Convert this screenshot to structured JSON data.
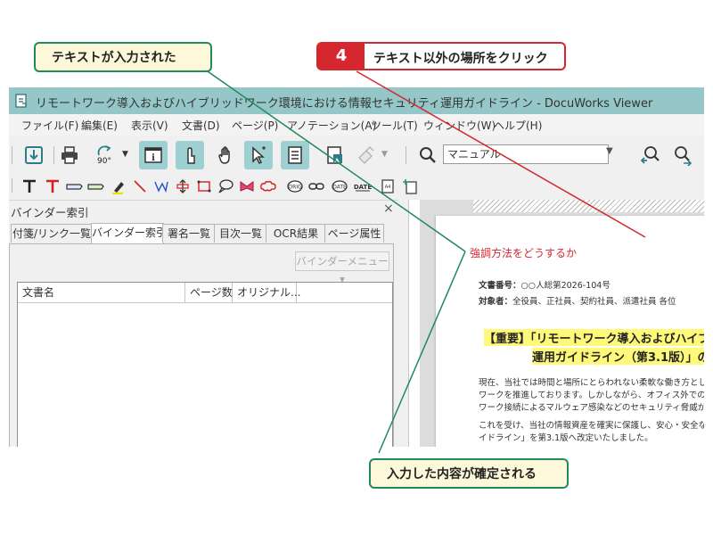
{
  "callouts": {
    "text_entered": "テキストが入力された",
    "step_number": "4",
    "step_text": "テキスト以外の場所をクリック",
    "confirmed": "入力した内容が確定される"
  },
  "window": {
    "title": "リモートワーク導入およびハイブリッドワーク環境における情報セキュリティ運用ガイドライン - DocuWorks Viewer"
  },
  "menu": [
    "ファイル(F)",
    "編集(E)",
    "表示(V)",
    "文書(D)",
    "ページ(P)",
    "アノテーション(A)",
    "ツール(T)",
    "ウィンドウ(W)",
    "ヘルプ(H)"
  ],
  "toolbar": {
    "rotate_label": "90°",
    "search_value": "マニュアル"
  },
  "left_pane": {
    "title": "バインダー索引",
    "close": "×",
    "tabs": [
      "付箋/リンク一覧",
      "バインダー索引",
      "署名一覧",
      "目次一覧",
      "OCR結果",
      "ページ属性"
    ],
    "binder_menu": "バインダーメニュー ▾",
    "columns": [
      "文書名",
      "ページ数",
      "オリジナル..."
    ]
  },
  "document": {
    "annotation": "強調方法をどうするか",
    "doc_number_label": "文書番号：",
    "doc_number_value": "○○人総第2026-104号",
    "target_label": "対象者：",
    "target_value": "全役員、正社員、契約社員、派遣社員 各位",
    "title_line1": "【重要】「リモートワーク導入およびハイブ",
    "title_line2": "運用ガイドライン（第3.1版）」の",
    "body": [
      "現在、当社では時間と場所にとらわれない柔軟な働き方とし",
      "ワークを推進しております。しかしながら、オフィス外での",
      "ワーク接続によるマルウェア感染などのセキュリティ脅威が",
      "これを受け、当社の情報資産を確実に保護し、安心・安全な",
      "イドライン」を第3.1版へ改定いたしました。"
    ]
  },
  "colors": {
    "titlebar": "#95c7c8",
    "active_button": "#9fd0d1",
    "callout_green": "#1f8a5a",
    "callout_red": "#d6272f",
    "highlight": "#fff97a"
  }
}
